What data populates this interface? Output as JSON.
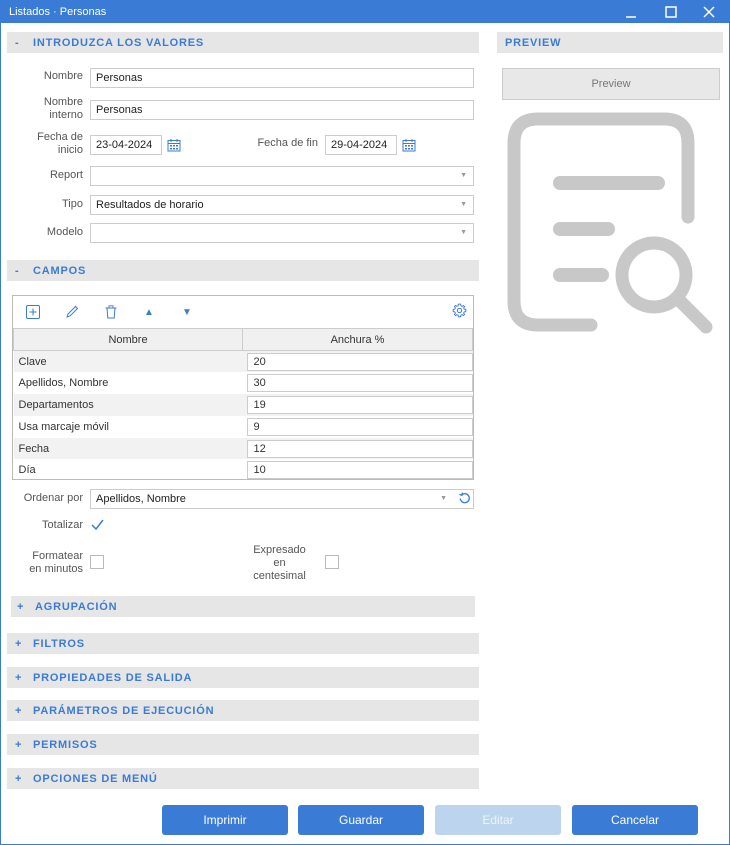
{
  "window": {
    "title": "Listados · Personas"
  },
  "sections": {
    "valores": {
      "sign": "-",
      "label": "INTRODUZCA LOS VALORES"
    },
    "preview": {
      "label": "PREVIEW"
    },
    "campos": {
      "sign": "-",
      "label": "CAMPOS"
    },
    "agrupacion": {
      "sign": "+",
      "label": "AGRUPACIÓN"
    },
    "filtros": {
      "sign": "+",
      "label": "FILTROS"
    },
    "propiedades": {
      "sign": "+",
      "label": "PROPIEDADES DE SALIDA"
    },
    "parametros": {
      "sign": "+",
      "label": "PARÁMETROS DE EJECUCIÓN"
    },
    "permisos": {
      "sign": "+",
      "label": "PERMISOS"
    },
    "opciones": {
      "sign": "+",
      "label": "OPCIONES DE MENÚ"
    }
  },
  "form": {
    "nombre_label": "Nombre",
    "nombre_value": "Personas",
    "nombre_interno_label_1": "Nombre",
    "nombre_interno_label_2": "interno",
    "nombre_interno_value": "Personas",
    "fecha_inicio_label_1": "Fecha de",
    "fecha_inicio_label_2": "inicio",
    "fecha_inicio_value": "23-04-2024",
    "fecha_fin_label": "Fecha de fin",
    "fecha_fin_value": "29-04-2024",
    "report_label": "Report",
    "report_value": "",
    "tipo_label": "Tipo",
    "tipo_value": "Resultados de horario",
    "modelo_label": "Modelo",
    "modelo_value": ""
  },
  "grid": {
    "columns": [
      "Nombre",
      "Anchura %"
    ],
    "rows": [
      {
        "name": "Clave",
        "width": "20"
      },
      {
        "name": "Apellidos, Nombre",
        "width": "30"
      },
      {
        "name": "Departamentos",
        "width": "19"
      },
      {
        "name": "Usa marcaje móvil",
        "width": "9"
      },
      {
        "name": "Fecha",
        "width": "12"
      },
      {
        "name": "Día",
        "width": "10"
      }
    ],
    "up_arrow": "▲",
    "down_arrow": "▼"
  },
  "options": {
    "ordenar_label": "Ordenar por",
    "ordenar_value": "Apellidos, Nombre",
    "totalizar_label": "Totalizar",
    "totalizar_checked": true,
    "formatear_label_1": "Formatear",
    "formatear_label_2": "en minutos",
    "formatear_checked": false,
    "expresado_label_1": "Expresado",
    "expresado_label_2": "en",
    "expresado_label_3": "centesimal",
    "expresado_checked": false
  },
  "preview": {
    "button_label": "Preview"
  },
  "buttons": {
    "imprimir": "Imprimir",
    "guardar": "Guardar",
    "editar": "Editar",
    "cancelar": "Cancelar"
  },
  "colors": {
    "accent": "#3a7bd5",
    "header_bg": "#e6e6e6",
    "preview_icon": "#c8c8c8"
  }
}
